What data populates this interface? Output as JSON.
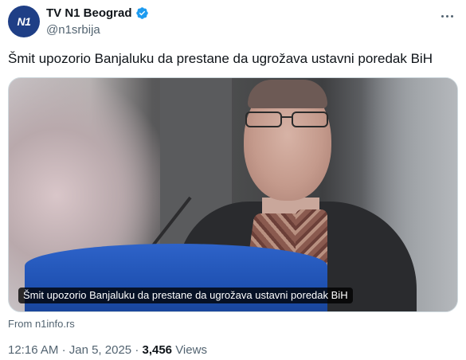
{
  "author": {
    "display_name": "TV N1 Beograd",
    "handle": "@n1srbija",
    "avatar_text": "N1",
    "avatar_color": "#1f3f86",
    "verified": true,
    "verified_color": "#1d9bf0"
  },
  "tweet": {
    "text": "Šmit upozorio Banjaluku da prestane da ugrožava ustavni poredak BiH"
  },
  "media": {
    "caption": "Šmit upozorio Banjaluku da prestane da ugrožava ustavni poredak BiH",
    "source": "From n1info.rs"
  },
  "meta": {
    "time": "12:16 AM",
    "separator": "·",
    "date": "Jan 5, 2025",
    "views_count": "3,456",
    "views_label": "Views"
  },
  "icons": {
    "more": "more-horizontal-icon",
    "verified": "verified-badge-icon"
  }
}
